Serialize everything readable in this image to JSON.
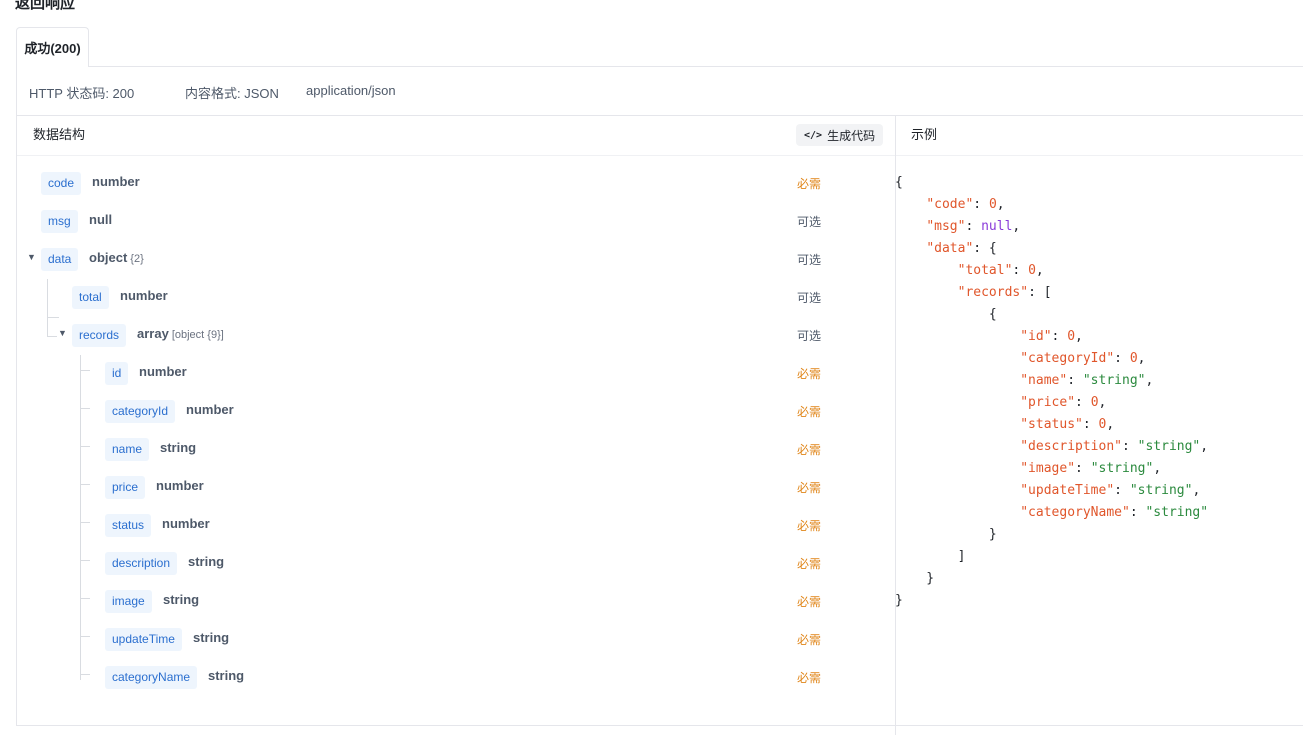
{
  "section_title": "返回响应",
  "tab_label": "成功(200)",
  "meta": {
    "status": "HTTP 状态码: 200",
    "format": "内容格式: JSON",
    "mime": "application/json"
  },
  "schema_header": "数据结构",
  "generate_code_label": "生成代码",
  "example_header": "示例",
  "fields": [
    {
      "name": "code",
      "type": "number",
      "sub": "",
      "required": "必需"
    },
    {
      "name": "msg",
      "type": "null",
      "sub": "",
      "required": "可选"
    },
    {
      "name": "data",
      "type": "object",
      "sub": "{2}",
      "required": "可选"
    },
    {
      "name": "total",
      "type": "number",
      "sub": "",
      "required": "可选"
    },
    {
      "name": "records",
      "type": "array",
      "sub": "[object {9}]",
      "required": "可选"
    },
    {
      "name": "id",
      "type": "number",
      "sub": "",
      "required": "必需"
    },
    {
      "name": "categoryId",
      "type": "number",
      "sub": "",
      "required": "必需"
    },
    {
      "name": "name",
      "type": "string",
      "sub": "",
      "required": "必需"
    },
    {
      "name": "price",
      "type": "number",
      "sub": "",
      "required": "必需"
    },
    {
      "name": "status",
      "type": "number",
      "sub": "",
      "required": "必需"
    },
    {
      "name": "description",
      "type": "string",
      "sub": "",
      "required": "必需"
    },
    {
      "name": "image",
      "type": "string",
      "sub": "",
      "required": "必需"
    },
    {
      "name": "updateTime",
      "type": "string",
      "sub": "",
      "required": "必需"
    },
    {
      "name": "categoryName",
      "type": "string",
      "sub": "",
      "required": "必需"
    }
  ],
  "example_lines": [
    "{",
    "    \"code\": 0,",
    "    \"msg\": null,",
    "    \"data\": {",
    "        \"total\": 0,",
    "        \"records\": [",
    "            {",
    "                \"id\": 0,",
    "                \"categoryId\": 0,",
    "                \"name\": \"string\",",
    "                \"price\": 0,",
    "                \"status\": 0,",
    "                \"description\": \"string\",",
    "                \"image\": \"string\",",
    "                \"updateTime\": \"string\",",
    "                \"categoryName\": \"string\"",
    "            }",
    "        ]",
    "    }",
    "}"
  ],
  "colors": {
    "tag_bg": "#eef5fd",
    "tag_text": "#2b6fcf",
    "required": "#e0861a",
    "json_key": "#e0562b",
    "json_string": "#2b8a3e",
    "json_null": "#8a3ad9"
  }
}
